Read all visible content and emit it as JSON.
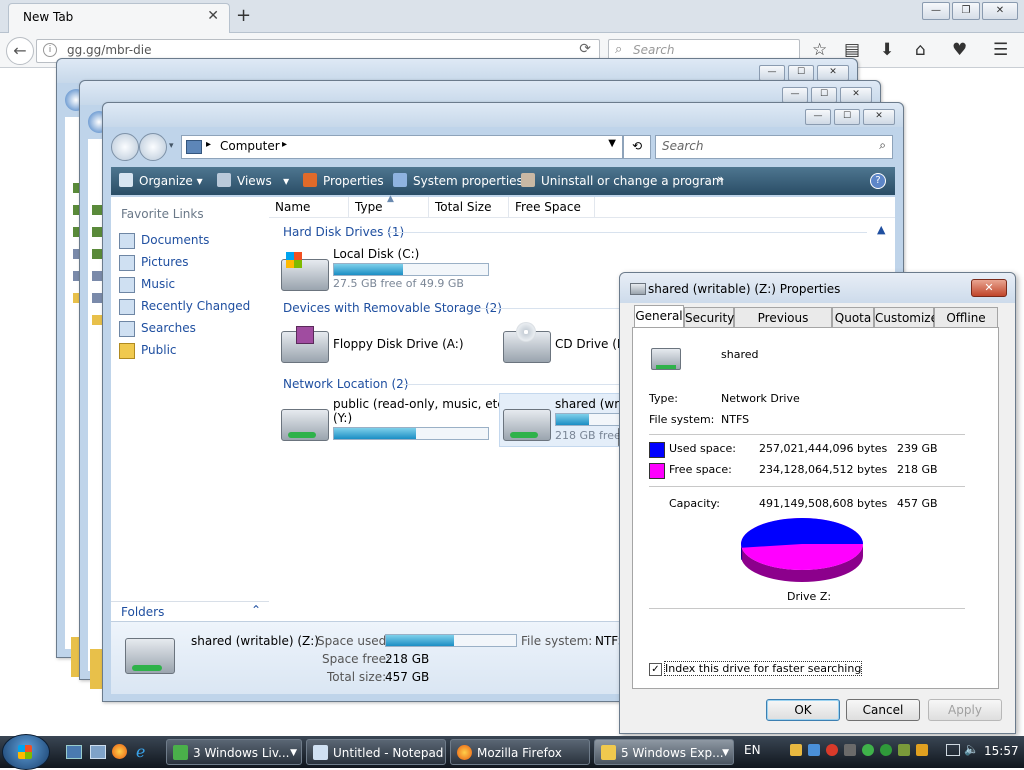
{
  "browser": {
    "tab_title": "New Tab",
    "tab_close": "✕",
    "new_tab": "+",
    "url": "gg.gg/mbr-die",
    "search_placeholder": "Search"
  },
  "explorer": {
    "address_segment": "Computer",
    "search_placeholder": "Search",
    "toolbar": {
      "organize": "Organize",
      "views": "Views",
      "properties": "Properties",
      "system_properties": "System properties",
      "uninstall": "Uninstall or change a program",
      "more": "»",
      "help": "?"
    },
    "favorite_links_label": "Favorite Links",
    "favorites": [
      "Documents",
      "Pictures",
      "Music",
      "Recently Changed",
      "Searches",
      "Public"
    ],
    "folders_label": "Folders",
    "columns": [
      "Name",
      "Type",
      "Total Size",
      "Free Space"
    ],
    "groups": {
      "hdd": "Hard Disk Drives (1)",
      "removable": "Devices with Removable Storage (2)",
      "network": "Network Location (2)"
    },
    "drives": {
      "c": {
        "name": "Local Disk (C:)",
        "sub": "27.5 GB free of 49.9 GB",
        "fill": 0.45
      },
      "floppy": {
        "name": "Floppy Disk Drive (A:)"
      },
      "cd": {
        "name": "CD Drive (E:)"
      },
      "y": {
        "name": "public (read-only, music, etc)",
        "name2": "(Y:)",
        "fill": 0.53
      },
      "z": {
        "name": "shared (writa",
        "sub": "218 GB free",
        "fill": 0.52
      }
    },
    "details": {
      "name": "shared (writable) (Z:)",
      "space_used_label": "Space used:",
      "space_free_label": "Space free:",
      "space_free": "218 GB",
      "total_size_label": "Total size:",
      "total_size": "457 GB",
      "fs_label": "File system:",
      "fs": "NTFS",
      "used_fill": 0.52
    }
  },
  "properties": {
    "title": "shared (writable) (Z:) Properties",
    "tabs": [
      "General",
      "Security",
      "Previous Versions",
      "Quota",
      "Customize",
      "Offline Files"
    ],
    "drive_label": "shared",
    "type_label": "Type:",
    "type": "Network Drive",
    "fs_label": "File system:",
    "fs": "NTFS",
    "used_label": "Used space:",
    "used_bytes": "257,021,444,096 bytes",
    "used_gb": "239 GB",
    "free_label": "Free space:",
    "free_bytes": "234,128,064,512 bytes",
    "free_gb": "218 GB",
    "capacity_label": "Capacity:",
    "capacity_bytes": "491,149,508,608 bytes",
    "capacity_gb": "457 GB",
    "drive_caption": "Drive Z:",
    "index_label": "Index this drive for faster searching",
    "index_checked": true,
    "ok": "OK",
    "cancel": "Cancel",
    "apply": "Apply",
    "used_color": "#0000ff",
    "free_color": "#ff00ff",
    "used_fraction": 0.523
  },
  "taskbar": {
    "buttons": [
      "3 Windows Liv...",
      "Untitled - Notepad",
      "Mozilla Firefox",
      "5 Windows Exp..."
    ],
    "lang": "EN",
    "clock": "15:57"
  }
}
